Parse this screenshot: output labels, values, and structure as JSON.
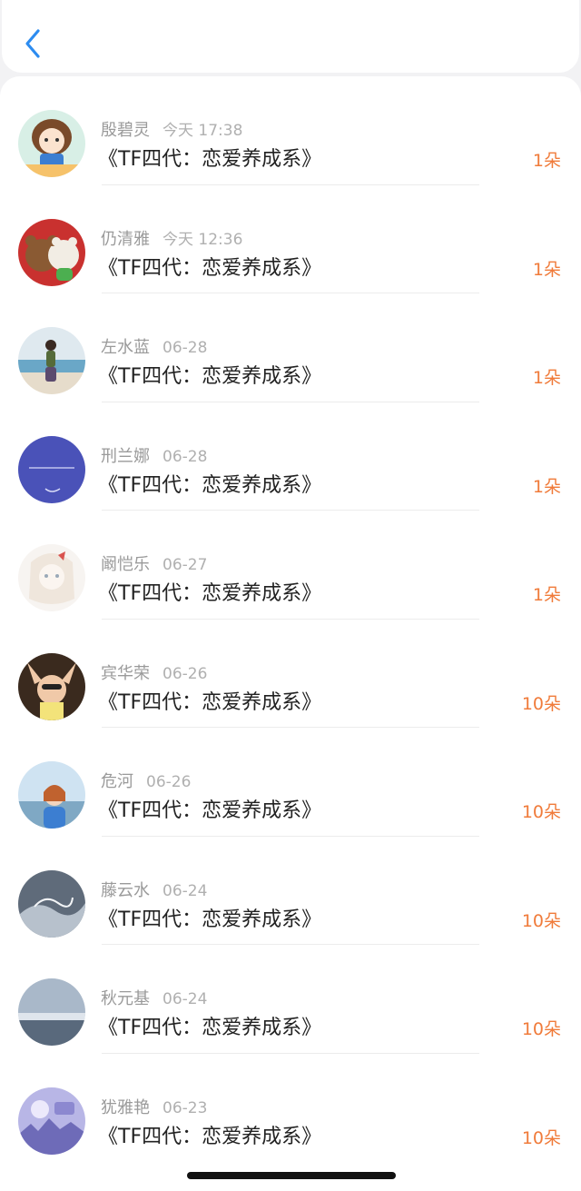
{
  "colors": {
    "accent_blue": "#2d8cf0",
    "count_orange": "#f07b3a",
    "name_gray": "#9a9a9a",
    "title_black": "#222222"
  },
  "header": {
    "back_icon": "chevron-left-icon"
  },
  "items": [
    {
      "name": "殷碧灵",
      "time": "今天 17:38",
      "title": "《TF四代：恋爱养成系》",
      "count": "1朵",
      "avatar": "cartoon-girl-avatar"
    },
    {
      "name": "仍清雅",
      "time": "今天 12:36",
      "title": "《TF四代：恋爱养成系》",
      "count": "1朵",
      "avatar": "teddy-bears-avatar"
    },
    {
      "name": "左水蓝",
      "time": "06-28",
      "title": "《TF四代：恋爱养成系》",
      "count": "1朵",
      "avatar": "beach-girl-avatar"
    },
    {
      "name": "刑兰娜",
      "time": "06-28",
      "title": "《TF四代：恋爱养成系》",
      "count": "1朵",
      "avatar": "purple-moon-avatar"
    },
    {
      "name": "阚恺乐",
      "time": "06-27",
      "title": "《TF四代：恋爱养成系》",
      "count": "1朵",
      "avatar": "sketch-girl-avatar"
    },
    {
      "name": "宾华荣",
      "time": "06-26",
      "title": "《TF四代：恋爱养成系》",
      "count": "10朵",
      "avatar": "sunglasses-girl-avatar"
    },
    {
      "name": "危河",
      "time": "06-26",
      "title": "《TF四代：恋爱养成系》",
      "count": "10朵",
      "avatar": "harbor-girl-avatar"
    },
    {
      "name": "藤云水",
      "time": "06-24",
      "title": "《TF四代：恋爱养成系》",
      "count": "10朵",
      "avatar": "hello-august-avatar"
    },
    {
      "name": "秋元基",
      "time": "06-24",
      "title": "《TF四代：恋爱养成系》",
      "count": "10朵",
      "avatar": "sea-sky-avatar"
    },
    {
      "name": "犹雅艳",
      "time": "06-23",
      "title": "《TF四代：恋爱养成系》",
      "count": "10朵",
      "avatar": "anime-city-avatar"
    }
  ]
}
